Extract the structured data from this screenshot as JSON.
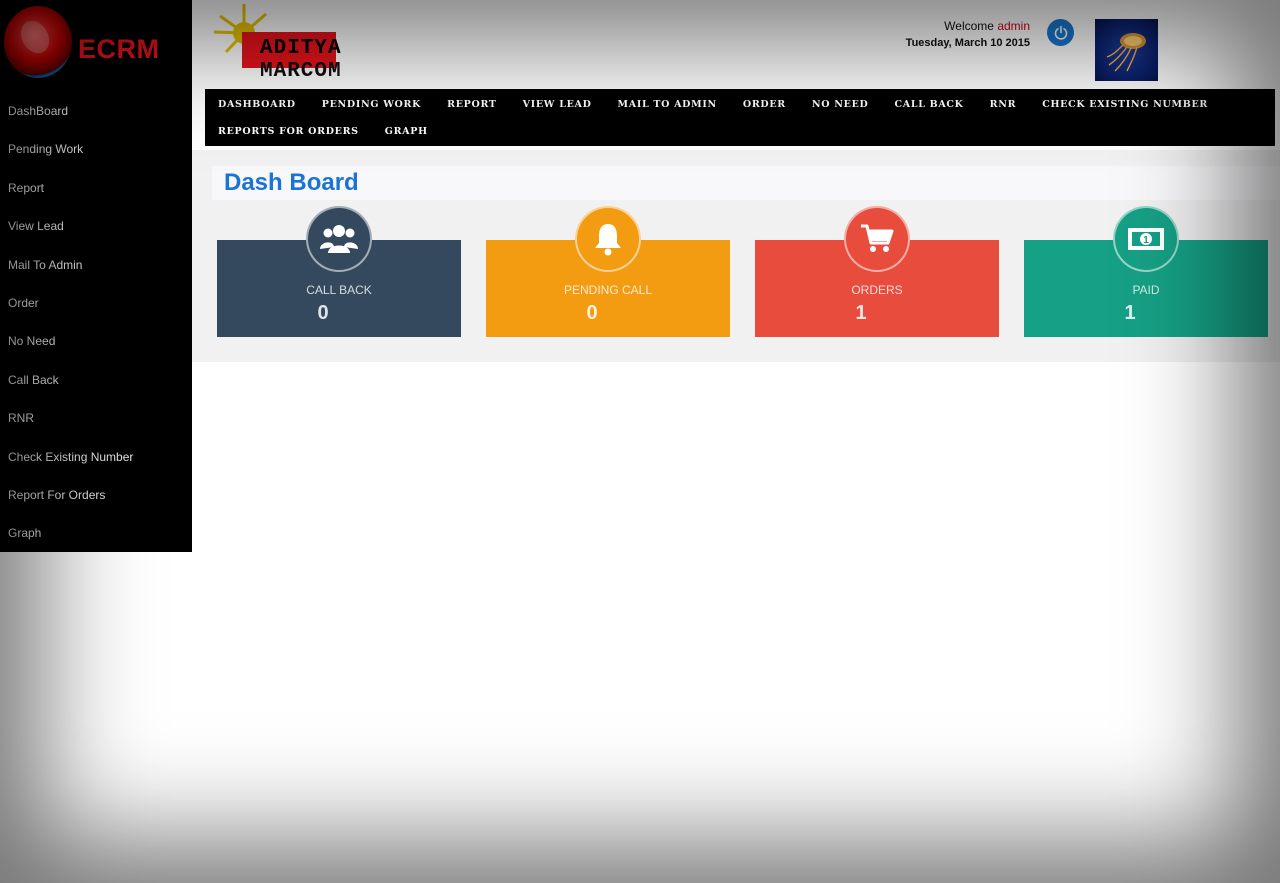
{
  "logo": {
    "text": "ECRM"
  },
  "sidebar": {
    "items": [
      {
        "label": "DashBoard"
      },
      {
        "label": "Pending Work"
      },
      {
        "label": "Report"
      },
      {
        "label": "View Lead"
      },
      {
        "label": "Mail To Admin"
      },
      {
        "label": "Order"
      },
      {
        "label": "No Need"
      },
      {
        "label": "Call Back"
      },
      {
        "label": "RNR"
      },
      {
        "label": "Check Existing Number"
      },
      {
        "label": "Report For Orders"
      },
      {
        "label": "Graph"
      }
    ]
  },
  "header": {
    "brand_part1": "ADITYA",
    "brand_part2": "MARCOM",
    "welcome_prefix": "Welcome",
    "user": "admin",
    "date": "Tuesday, March 10 2015"
  },
  "topnav": {
    "items": [
      {
        "label": "DASHBOARD"
      },
      {
        "label": "PENDING WORK"
      },
      {
        "label": "REPORT"
      },
      {
        "label": "VIEW LEAD"
      },
      {
        "label": "MAIL TO ADMIN"
      },
      {
        "label": "ORDER"
      },
      {
        "label": "NO NEED"
      },
      {
        "label": "CALL BACK"
      },
      {
        "label": "RNR"
      },
      {
        "label": "CHECK EXISTING NUMBER"
      },
      {
        "label": "REPORTS FOR ORDERS"
      },
      {
        "label": "GRAPH"
      }
    ]
  },
  "main": {
    "title": "Dash Board",
    "cards": [
      {
        "label": "CALL BACK",
        "count": "0",
        "color": "#34495e",
        "icon": "users-icon"
      },
      {
        "label": "PENDING CALL",
        "count": "0",
        "color": "#f39c12",
        "icon": "bell-icon"
      },
      {
        "label": "ORDERS",
        "count": "1",
        "color": "#e74c3c",
        "icon": "cart-icon"
      },
      {
        "label": "PAID",
        "count": "1",
        "color": "#16a085",
        "icon": "money-icon"
      }
    ]
  }
}
